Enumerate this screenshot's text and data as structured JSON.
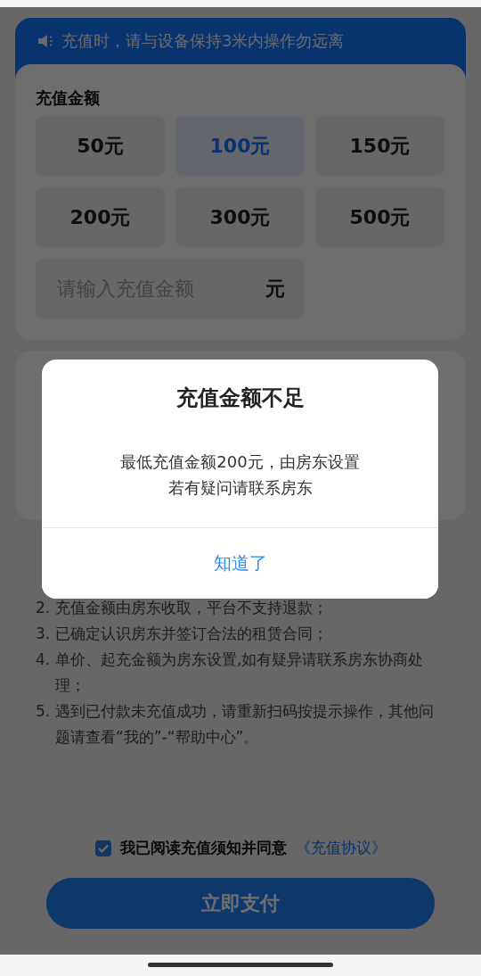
{
  "notice": {
    "text": "充值时，请与设备保持3米内操作勿远离"
  },
  "amount_section": {
    "title": "充值金额",
    "options": [
      {
        "label": "50元",
        "selected": false
      },
      {
        "label": "100元",
        "selected": true
      },
      {
        "label": "150元",
        "selected": false
      },
      {
        "label": "200元",
        "selected": false
      },
      {
        "label": "300元",
        "selected": false
      },
      {
        "label": "500元",
        "selected": false
      }
    ],
    "custom": {
      "placeholder": "请输入充值金额",
      "unit": "元"
    }
  },
  "notes": {
    "items": [
      {
        "number": "2.",
        "text": "充值金额由房东收取，平台不支持退款；"
      },
      {
        "number": "3.",
        "text": "已确定认识房东并签订合法的租赁合同；"
      },
      {
        "number": "4.",
        "text": "单价、起充金额为房东设置,如有疑异请联系房东协商处理；"
      },
      {
        "number": "5.",
        "text": "遇到已付款未充值成功，请重新扫码按提示操作，其他问题请查看“我的”-“帮助中心”。"
      }
    ]
  },
  "agreement": {
    "checked": true,
    "text": "我已阅读充值须知并同意",
    "link": "《充值协议》"
  },
  "pay_button": {
    "label": "立即支付"
  },
  "dialog": {
    "title": "充值金额不足",
    "message": [
      "最低充值金额200元，由房东设置",
      "若有疑问请联系房东"
    ],
    "button": "知道了"
  }
}
